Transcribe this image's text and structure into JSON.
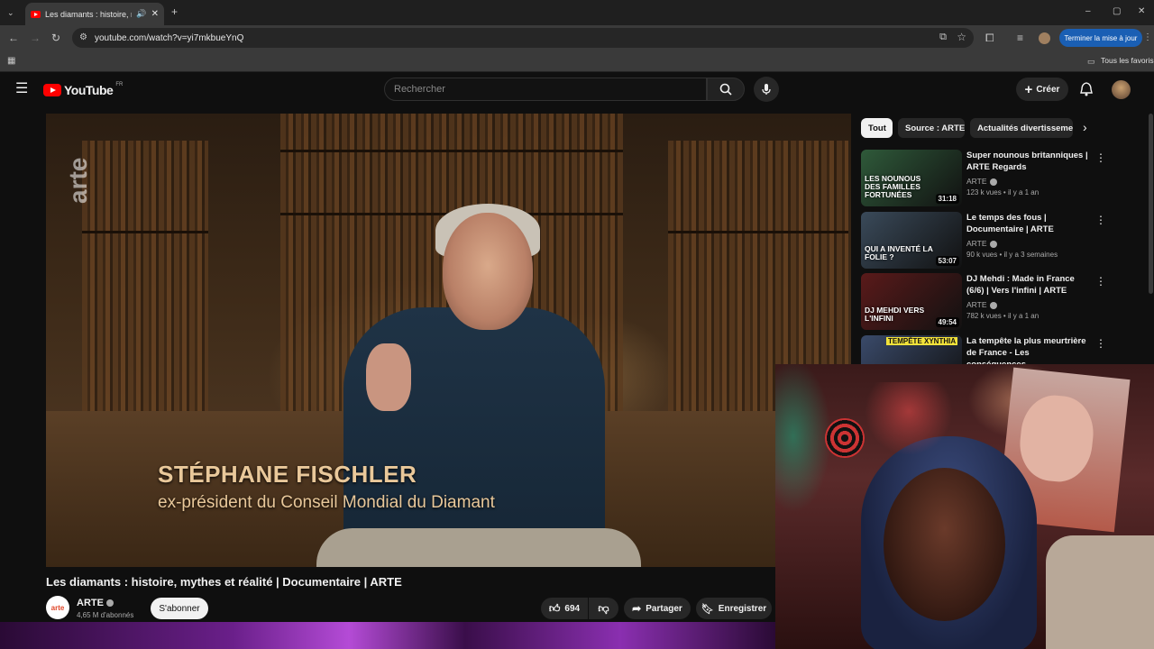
{
  "browser": {
    "tab_title": "Les diamants : histoire, myth",
    "url": "youtube.com/watch?v=yi7mkbueYnQ",
    "update_button": "Terminer la mise à jour",
    "bookmarks_all": "Tous les favoris"
  },
  "youtube": {
    "logo_text": "YouTube",
    "logo_region": "FR",
    "search_placeholder": "Rechercher",
    "create_label": "Créer"
  },
  "video": {
    "channel_watermark": "arte",
    "caption_name": "STÉPHANE FISCHLER",
    "caption_role": "ex-président du Conseil Mondial du Diamant",
    "title": "Les diamants : histoire, mythes et réalité | Documentaire | ARTE",
    "channel": "ARTE",
    "channel_avatar": "arte",
    "subscribers": "4,65 M d'abonnés",
    "subscribe_label": "S'abonner",
    "likes": "694",
    "share_label": "Partager",
    "save_label": "Enregistrer"
  },
  "chips": [
    "Tout",
    "Source : ARTE",
    "Actualités divertissemen"
  ],
  "recommendations": [
    {
      "title": "Super nounous britanniques | ARTE Regards",
      "channel": "ARTE",
      "meta": "123 k vues • il y a 1 an",
      "duration": "31:18",
      "thumb_text": "LES NOUNOUS DES FAMILLES FORTUNÉES",
      "thumb_color": "#2f5a3a"
    },
    {
      "title": "Le temps des fous | Documentaire | ARTE",
      "channel": "ARTE",
      "meta": "90 k vues • il y a 3 semaines",
      "duration": "53:07",
      "thumb_text": "QUI A INVENTÉ LA FOLIE ?",
      "thumb_color": "#3a4a5a"
    },
    {
      "title": "DJ Mehdi : Made in France (6/6) | Vers l'infini | ARTE",
      "channel": "ARTE",
      "meta": "782 k vues • il y a 1 an",
      "duration": "49:54",
      "thumb_text": "DJ MEHDI VERS L'INFINI",
      "thumb_color": "#5a1a1a"
    },
    {
      "title": "La tempête la plus meurtrière de France - Les conséquences...",
      "channel": "",
      "meta": "",
      "duration": "",
      "thumb_text": "TEMPÊTE XYNTHIA",
      "thumb_color": "#3a4a6a"
    }
  ],
  "colors": {
    "accent": "#ff0000",
    "arte": "#e0472a",
    "update": "#1a5fb4"
  }
}
